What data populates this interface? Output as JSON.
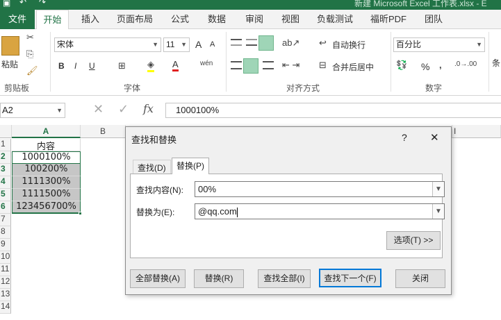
{
  "window": {
    "title": "新建 Microsoft Excel 工作表.xlsx - E"
  },
  "tabs": [
    "文件",
    "开始",
    "插入",
    "页面布局",
    "公式",
    "数据",
    "审阅",
    "视图",
    "负载测试",
    "福昕PDF",
    "团队"
  ],
  "ribbon": {
    "clipboard": {
      "paste": "粘贴",
      "label": "剪贴板"
    },
    "font": {
      "name": "宋体",
      "size": "11",
      "label": "字体",
      "bold": "B",
      "italic": "I",
      "underline": "U",
      "grow": "A",
      "shrink": "A"
    },
    "align": {
      "wrap": "自动换行",
      "merge": "合并后居中",
      "label": "对齐方式"
    },
    "number": {
      "format": "百分比",
      "label": "数字",
      "percent": "%"
    },
    "extra": "条"
  },
  "formula_bar": {
    "name_box": "A2",
    "value": "1000100%",
    "fx": "fx"
  },
  "columns": [
    "A",
    "B",
    "I"
  ],
  "rows": [
    "1",
    "2",
    "3",
    "4",
    "5",
    "6",
    "7",
    "8",
    "9",
    "10",
    "11",
    "12",
    "13",
    "14"
  ],
  "cells": {
    "header": "内容",
    "values": [
      "1000100%",
      "100200%",
      "1111300%",
      "1111500%",
      "123456700%"
    ]
  },
  "dialog": {
    "title": "查找和替换",
    "help": "?",
    "close": "✕",
    "tab_find": "查找(D)",
    "tab_replace": "替换(P)",
    "find_label": "查找内容(N):",
    "find_value": "00%",
    "replace_label": "替换为(E):",
    "replace_value": "@qq.com",
    "options": "选项(T) >>",
    "replace_all": "全部替换(A)",
    "replace": "替换(R)",
    "find_all": "查找全部(I)",
    "find_next": "查找下一个(F)",
    "close_btn": "关闭"
  }
}
